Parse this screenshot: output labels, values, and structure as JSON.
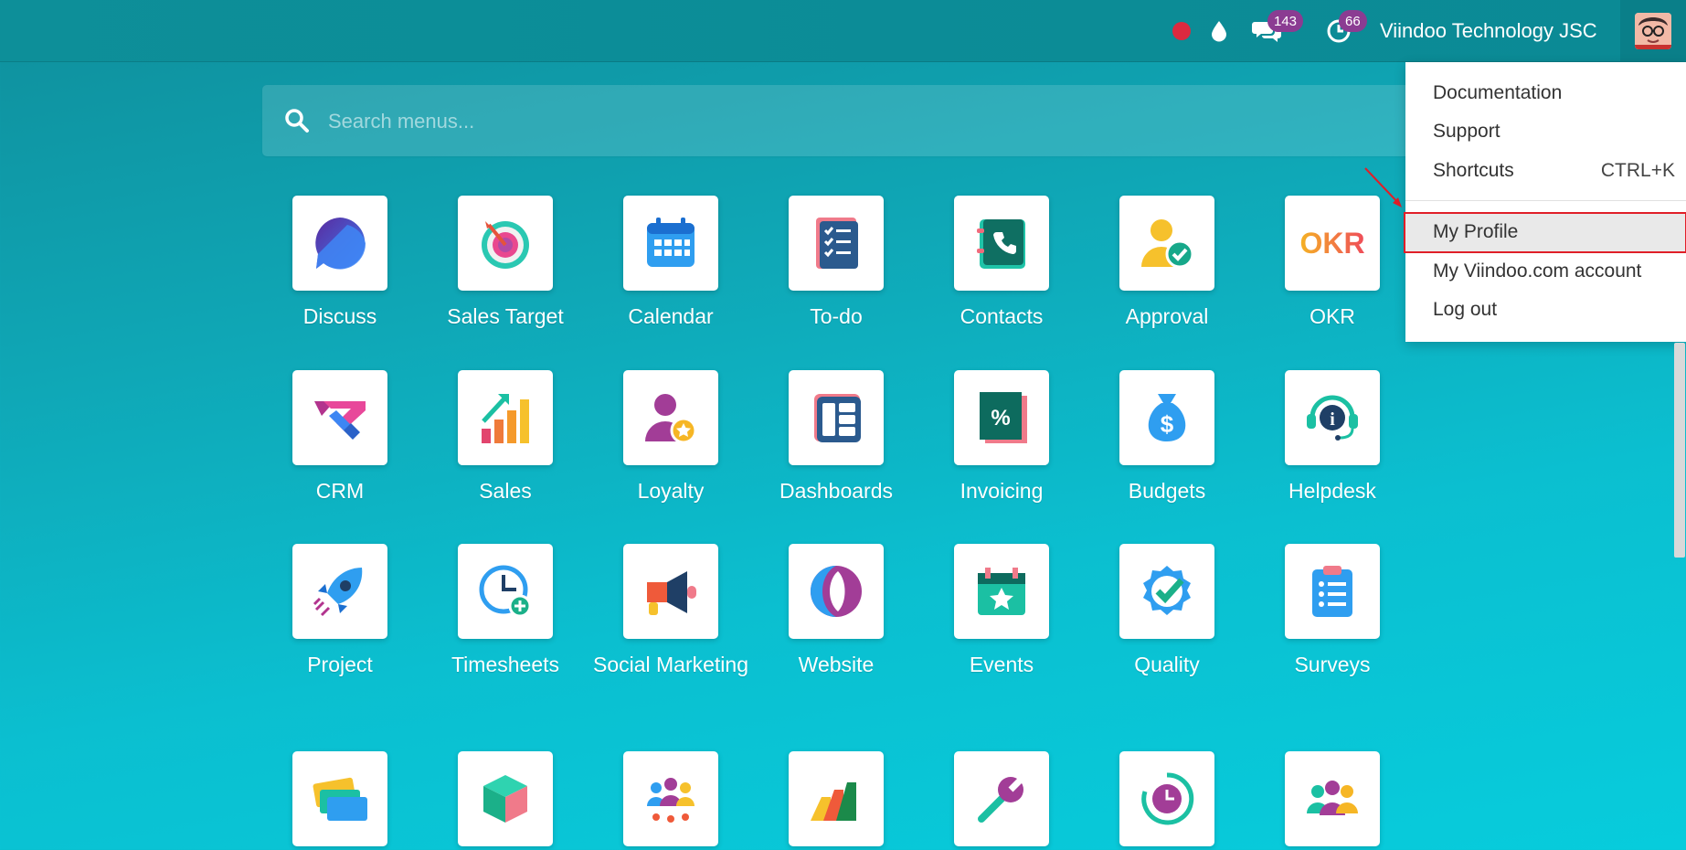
{
  "topbar": {
    "chat_count": "143",
    "activity_count": "66",
    "company": "Viindoo Technology JSC"
  },
  "search": {
    "placeholder": "Search menus..."
  },
  "apps": [
    {
      "label": "Discuss",
      "icon": "discuss-icon"
    },
    {
      "label": "Sales Target",
      "icon": "sales-target-icon"
    },
    {
      "label": "Calendar",
      "icon": "calendar-icon"
    },
    {
      "label": "To-do",
      "icon": "todo-icon"
    },
    {
      "label": "Contacts",
      "icon": "contacts-icon"
    },
    {
      "label": "Approval",
      "icon": "approval-icon"
    },
    {
      "label": "OKR",
      "icon": "okr-icon"
    },
    {
      "label": "CRM",
      "icon": "crm-icon"
    },
    {
      "label": "Sales",
      "icon": "sales-icon"
    },
    {
      "label": "Loyalty",
      "icon": "loyalty-icon"
    },
    {
      "label": "Dashboards",
      "icon": "dashboards-icon"
    },
    {
      "label": "Invoicing",
      "icon": "invoicing-icon"
    },
    {
      "label": "Budgets",
      "icon": "budgets-icon"
    },
    {
      "label": "Helpdesk",
      "icon": "helpdesk-icon"
    },
    {
      "label": "Project",
      "icon": "project-icon"
    },
    {
      "label": "Timesheets",
      "icon": "timesheets-icon"
    },
    {
      "label": "Social Marketing",
      "icon": "social-marketing-icon"
    },
    {
      "label": "Website",
      "icon": "website-icon"
    },
    {
      "label": "Events",
      "icon": "events-icon"
    },
    {
      "label": "Quality",
      "icon": "quality-icon"
    },
    {
      "label": "Surveys",
      "icon": "surveys-icon"
    }
  ],
  "okr_text": "OKR",
  "invoice_glyph": "%",
  "budget_glyph": "$",
  "helpdesk_glyph": "i",
  "user_menu": {
    "documentation": "Documentation",
    "support": "Support",
    "shortcuts": "Shortcuts",
    "shortcuts_key": "CTRL+K",
    "my_profile": "My Profile",
    "account": "My Viindoo.com account",
    "logout": "Log out"
  },
  "colors": {
    "highlight_border": "#e01f28",
    "badge": "#8b3c92",
    "record": "#dc2a3f"
  }
}
